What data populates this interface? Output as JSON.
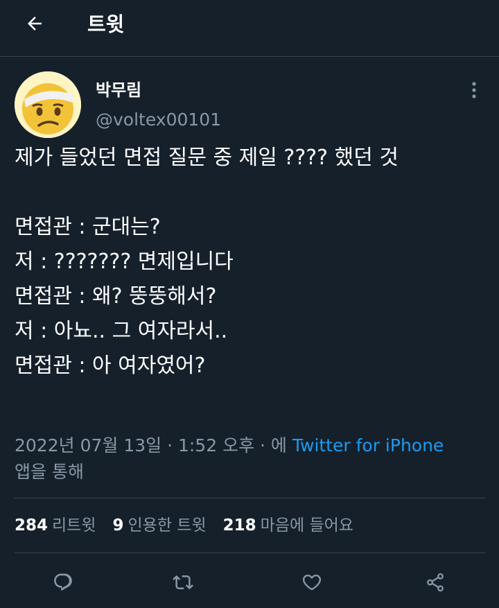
{
  "header": {
    "title": "트윗",
    "back_icon": "arrow-left-icon"
  },
  "user": {
    "name": "박무림",
    "handle": "@voltex00101",
    "avatar": "worried-bandaged-emoji-avatar"
  },
  "tweet": {
    "text": "제가 들었던 면접 질문 중 제일 ???? 했던 것\n\n면접관 : 군대는?\n저 : ??????? 면제입니다\n면접관 : 왜? 뚱뚱해서?\n저 : 아뇨.. 그 여자라서..\n면접관 : 아 여자였어?"
  },
  "meta": {
    "timestamp": "2022년 07월 13일 · 1:52 오후 · 에 ",
    "source": "Twitter for iPhone",
    "suffix": "앱을 통해"
  },
  "stats": {
    "retweets": {
      "count": "284",
      "label": "리트윗"
    },
    "quotes": {
      "count": "9",
      "label": "인용한 트윗"
    },
    "likes": {
      "count": "218",
      "label": "마음에 들어요"
    }
  },
  "actions": [
    "reply-icon",
    "retweet-icon",
    "like-icon",
    "share-icon"
  ],
  "colors": {
    "background": "#15202b",
    "text": "#ffffff",
    "secondary": "#8899a6",
    "accent": "#1d9bf0",
    "divider": "#38444d"
  }
}
